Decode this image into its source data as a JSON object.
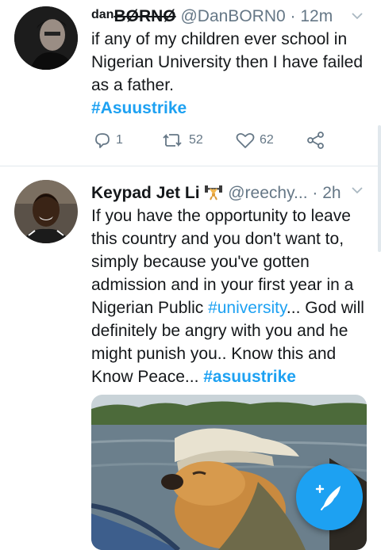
{
  "tweets": [
    {
      "display_name": "dan",
      "display_name_suffix": "BØRNØ",
      "handle": "@DanBORN0",
      "time": "· 12m",
      "text": "if any of my children ever school in Nigerian University then I have failed as a father.",
      "hashtag": "#Asuustrike",
      "replies": "1",
      "retweets": "52",
      "likes": "62"
    },
    {
      "display_name": "Keypad Jet Li",
      "emoji_icon": "weightlifter-icon",
      "handle": "@reechy...",
      "time": "· 2h",
      "text_part1": "If you have the opportunity to leave this country and you don't want to, simply because you've gotten admission and in your first year in a Nigerian Public ",
      "hashtag_inline": "#university",
      "text_part2": "... God will definitely be angry with you and he might punish you.. Know this and Know Peace...  ",
      "hashtag_end": "#asuustrike"
    }
  ],
  "colors": {
    "accent": "#1da1f2",
    "muted": "#657786",
    "text": "#14171a"
  }
}
